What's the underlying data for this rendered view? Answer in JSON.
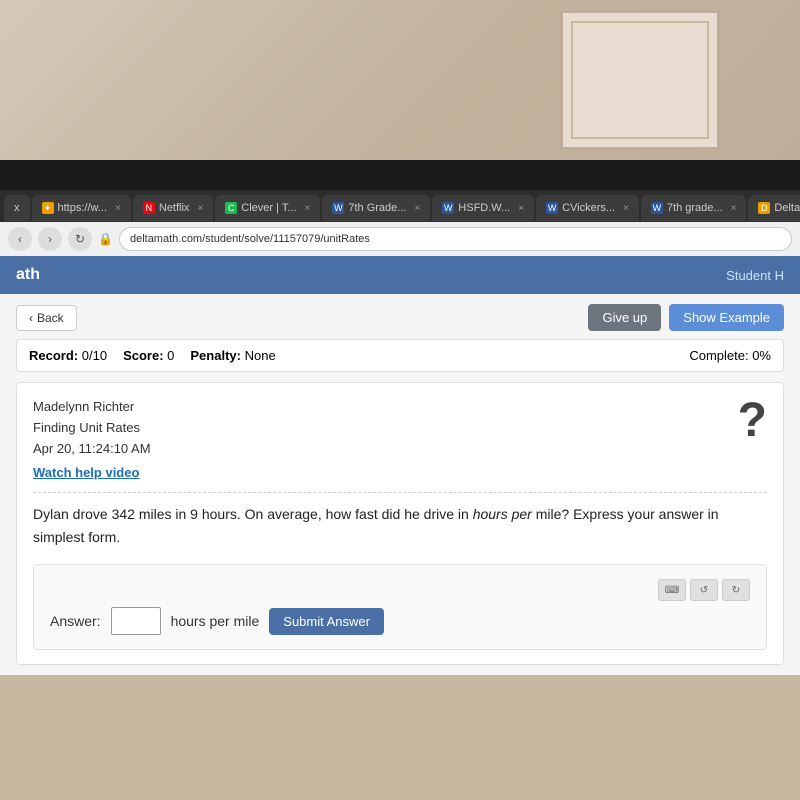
{
  "room": {
    "bg_description": "Room background with door"
  },
  "browser": {
    "tabs": [
      {
        "label": "x",
        "icon_color": "#e8a000",
        "active": false
      },
      {
        "label": "https://w...",
        "icon_color": "#e8a000",
        "active": false,
        "close": "x"
      },
      {
        "label": "Netflix",
        "icon_color": "#e50914",
        "active": false,
        "close": "x"
      },
      {
        "label": "Clever | T...",
        "icon_color": "#1db954",
        "active": false,
        "close": "x"
      },
      {
        "label": "7th Grade...",
        "icon_color": "#2b579a",
        "active": false,
        "close": "x"
      },
      {
        "label": "HSFD.W...",
        "icon_color": "#2b579a",
        "active": false,
        "close": "x"
      },
      {
        "label": "CVickers...",
        "icon_color": "#2b579a",
        "active": false,
        "close": "x"
      },
      {
        "label": "7th grade...",
        "icon_color": "#2b579a",
        "active": false,
        "close": "x"
      },
      {
        "label": "DeltaMat...",
        "icon_color": "#e8a000",
        "active": false,
        "close": "x"
      }
    ],
    "address": "deltamath.com/student/solve/11157079/unitRates"
  },
  "app": {
    "title": "ath",
    "student_label": "Student H"
  },
  "actions": {
    "back_label": "Back",
    "give_up_label": "Give up",
    "show_example_label": "Show Example"
  },
  "record": {
    "record_label": "Record:",
    "record_value": "0/10",
    "score_label": "Score:",
    "score_value": "0",
    "penalty_label": "Penalty:",
    "penalty_value": "None",
    "complete_label": "Complete:",
    "complete_value": "0%"
  },
  "problem": {
    "student_name": "Madelynn Richter",
    "topic": "Finding Unit Rates",
    "date": "Apr 20, 11:24:10 AM",
    "watch_help": "Watch help video",
    "question": "Dylan drove 342 miles in 9 hours. On average, how fast did he drive in",
    "question_italic": "hours per",
    "question_end": "mile? Express your answer in simplest form.",
    "answer_label": "Answer:",
    "answer_placeholder": "",
    "answer_unit": "hours per mile",
    "submit_label": "Submit Answer"
  }
}
